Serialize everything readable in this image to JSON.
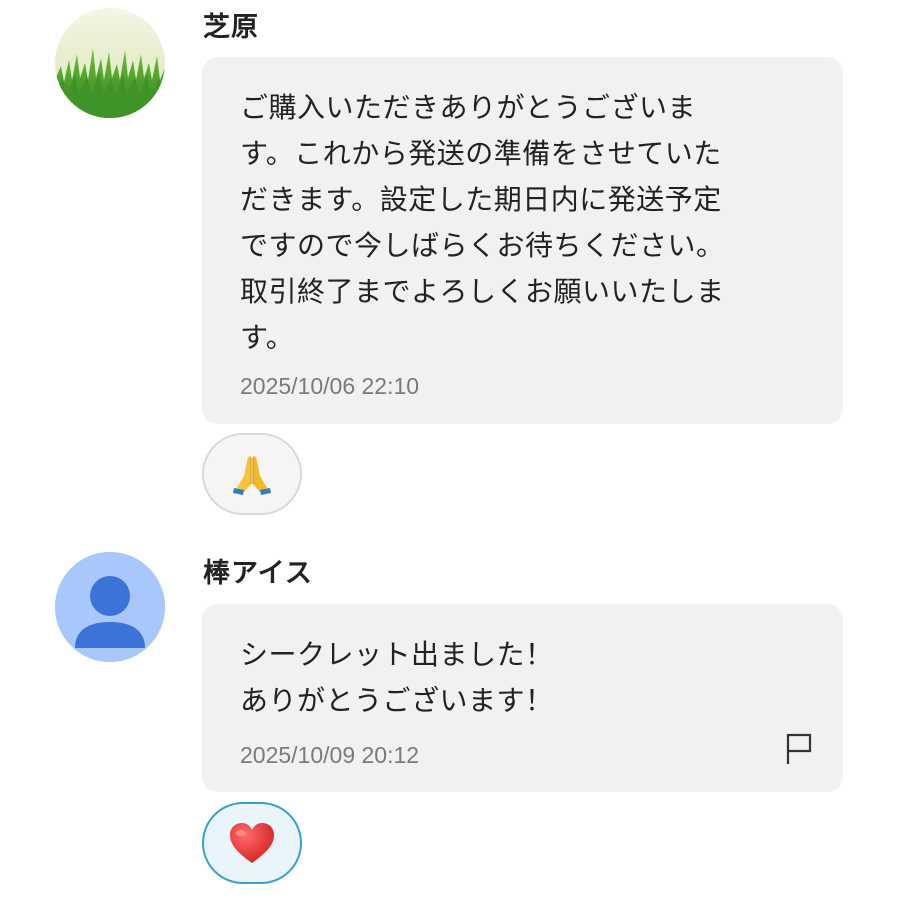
{
  "messages": [
    {
      "username": "芝原",
      "avatar": "grass-photo-avatar",
      "text": "ご購入いただきありがとうございま\nす。これから発送の準備をさせていた\nだきます。設定した期日内に発送予定\nですので今しばらくお待ちください。\n取引終了までよろしくお願いいたしま\nす。",
      "timestamp": "2025/10/06 22:10",
      "reaction": "🙏",
      "reaction_icon": "praying-hands-icon"
    },
    {
      "username": "棒アイス",
      "avatar": "default-person-avatar",
      "text": "シークレット出ました！\nありがとうございます！",
      "timestamp": "2025/10/09 20:12",
      "report_icon": "flag-icon",
      "reaction": "❤️",
      "reaction_icon": "red-heart-icon"
    }
  ],
  "colors": {
    "bubble_bg": "#f1f1f1",
    "timestamp": "#7a7a7a",
    "avatar_default_bg": "#a8c7fa",
    "avatar_default_figure": "#3b73d9",
    "reaction_selected_border": "#3a9fd0",
    "reaction_selected_bg": "#eaf5fb"
  }
}
